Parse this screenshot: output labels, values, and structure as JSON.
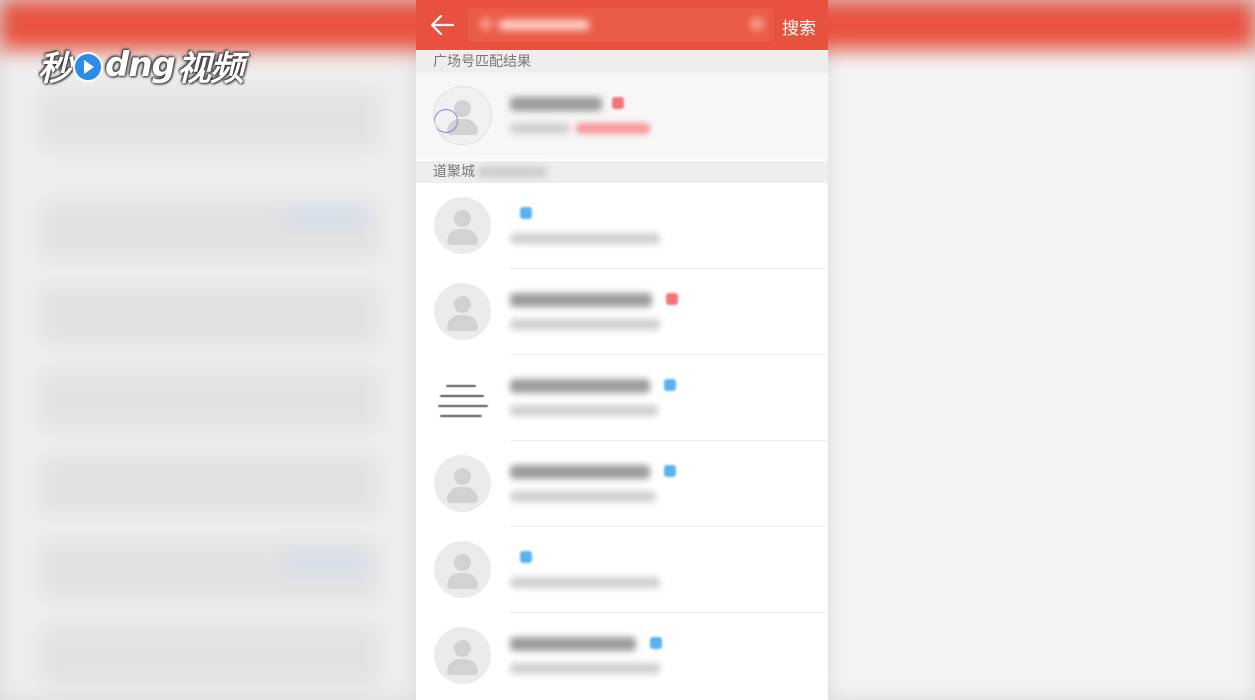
{
  "watermark": {
    "text_left": "秒",
    "text_mid": "dng",
    "text_right": "视频"
  },
  "header": {
    "search_button_label": "搜索",
    "search_value": ""
  },
  "sections": {
    "square_match_title": "广场号匹配结果",
    "city_match_title": "道聚城"
  },
  "colors": {
    "accent": "#e8513e",
    "verified_blue": "#5ab2f2",
    "vip_red": "#f5737a"
  },
  "icons": {
    "back": "arrow-left-icon",
    "avatar": "default-avatar-icon"
  },
  "results": [
    {
      "badge": "red",
      "highlighted": true
    },
    {
      "badge": "blue"
    },
    {
      "badge": "red"
    },
    {
      "badge": "blue"
    },
    {
      "badge": "blue"
    },
    {
      "badge": "blue"
    },
    {
      "badge": "blue"
    }
  ]
}
